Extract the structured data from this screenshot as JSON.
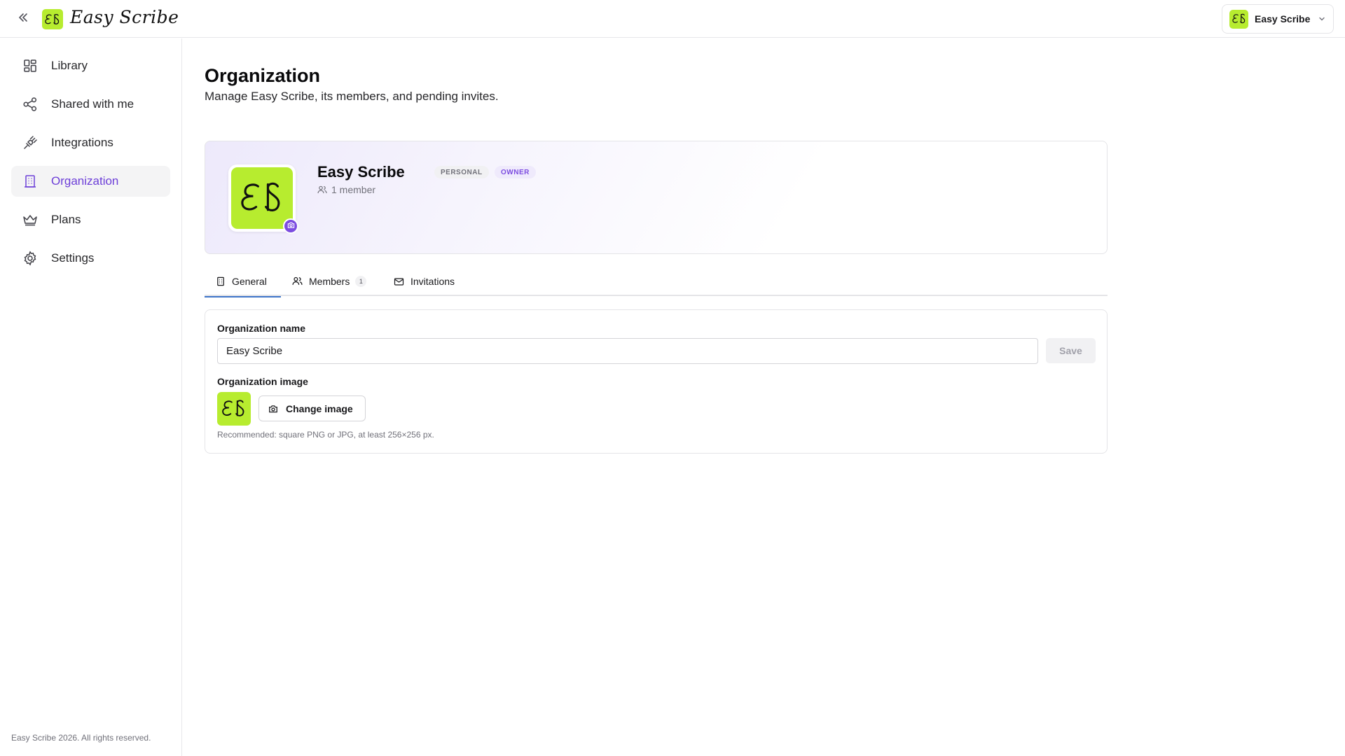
{
  "app": {
    "brand_initials": "ES",
    "brand_name": "Easy Scribe",
    "brand_color": "#b7ec2f",
    "accent_color": "#6d3fd8"
  },
  "topbar": {
    "collapse_icon": "double-chevron-left-icon",
    "org_switcher_label": "Easy Scribe"
  },
  "sidebar": {
    "items": [
      {
        "label": "Library",
        "icon": "grid-icon",
        "active": false
      },
      {
        "label": "Shared with me",
        "icon": "share-icon",
        "active": false
      },
      {
        "label": "Integrations",
        "icon": "plug-icon",
        "active": false
      },
      {
        "label": "Organization",
        "icon": "building-icon",
        "active": true
      },
      {
        "label": "Plans",
        "icon": "crown-icon",
        "active": false
      },
      {
        "label": "Settings",
        "icon": "gear-icon",
        "active": false
      }
    ],
    "footer": "Easy Scribe 2026. All rights reserved."
  },
  "header": {
    "title": "Organization",
    "subtitle": "Manage Easy Scribe, its members, and pending invites."
  },
  "org_card": {
    "name": "Easy Scribe",
    "badge_personal": "PERSONAL",
    "badge_owner": "OWNER",
    "member_count": "1 member"
  },
  "tabs": [
    {
      "label": "General",
      "icon": "building-icon",
      "active": true
    },
    {
      "label": "Members",
      "icon": "users-icon",
      "count": "1"
    },
    {
      "label": "Invitations",
      "icon": "mail-icon"
    }
  ],
  "form": {
    "name_label": "Organization name",
    "name_value": "Easy Scribe",
    "save_label": "Save",
    "image_label": "Organization image",
    "change_image_label": "Change image",
    "hint": "Recommended: square PNG or JPG, at least 256×256 px."
  }
}
